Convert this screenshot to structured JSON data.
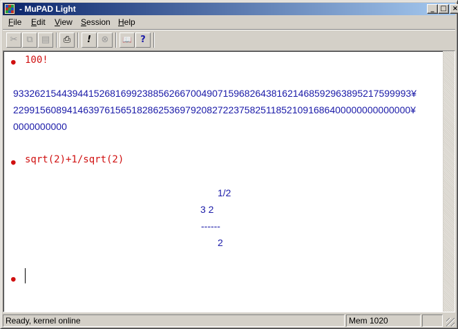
{
  "window": {
    "title": "- MuPAD Light",
    "icon": "mupad-app-icon",
    "controls": {
      "minimize": "_",
      "maximize": "□",
      "close": "×"
    }
  },
  "menu": {
    "items": [
      {
        "label": "File",
        "underline": "F"
      },
      {
        "label": "Edit",
        "underline": "E"
      },
      {
        "label": "View",
        "underline": "V"
      },
      {
        "label": "Session",
        "underline": "S"
      },
      {
        "label": "Help",
        "underline": "H"
      }
    ]
  },
  "toolbar": {
    "buttons": [
      {
        "name": "cut-icon",
        "glyph": "✂",
        "enabled": false
      },
      {
        "name": "copy-icon",
        "glyph": "⧉",
        "enabled": false
      },
      {
        "name": "paste-icon",
        "glyph": "▤",
        "enabled": false
      },
      {
        "name": "print-icon",
        "glyph": "⎙",
        "enabled": true
      },
      {
        "name": "evaluate-icon",
        "glyph": "!",
        "enabled": true
      },
      {
        "name": "stop-icon",
        "glyph": "⊗",
        "enabled": false
      },
      {
        "name": "help-book-icon",
        "glyph": "📖",
        "enabled": true
      },
      {
        "name": "help-search-icon",
        "glyph": "?",
        "enabled": true
      }
    ]
  },
  "notebook": {
    "cells": [
      {
        "input": "100!",
        "output_lines": [
          "93326215443944152681699238856266700490715968264381621468592963895217599993¥",
          "22991560894146397615651828625369792082722375825118521091686400000000000000¥",
          "0000000000"
        ]
      },
      {
        "input": "sqrt(2)+1/sqrt(2)",
        "output_fraction": {
          "exponent": "1/2",
          "numerator": "3 2",
          "bar": "------",
          "denominator": "2"
        }
      },
      {
        "input": ""
      }
    ]
  },
  "status": {
    "message": "Ready, kernel online",
    "memory": "Mem 1020",
    "extra": ""
  }
}
